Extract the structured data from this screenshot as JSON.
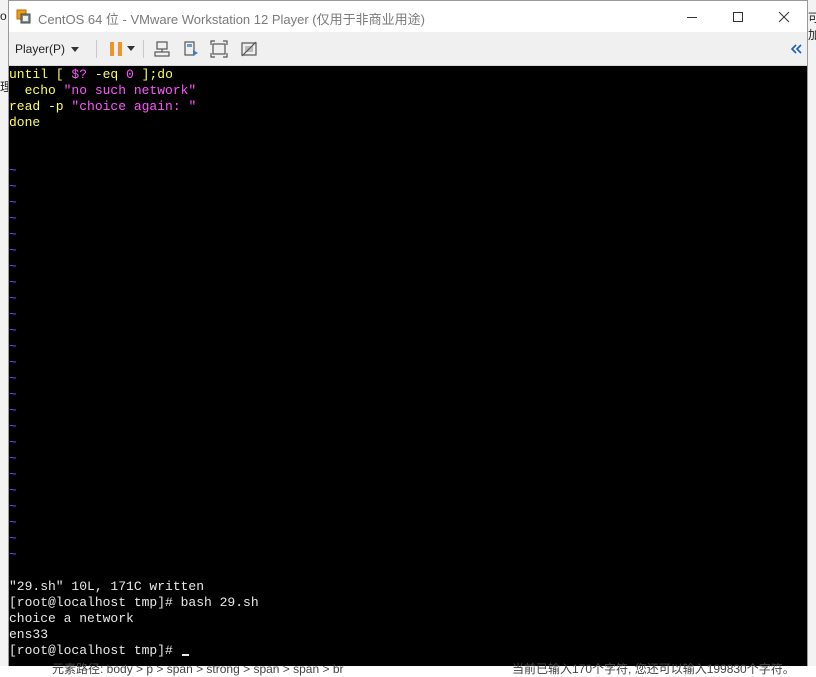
{
  "window": {
    "title": "CentOS 64 位 - VMware Workstation 12 Player (仅用于非商业用途)",
    "icon": "vmware-player-icon",
    "controls": [
      "minimize-icon",
      "maximize-icon",
      "close-icon"
    ]
  },
  "toolbar": {
    "player_menu_label": "Player(P)",
    "buttons": [
      "pause-icon",
      "send-ctrl-alt-del-icon",
      "removable-devices-icon",
      "full-screen-icon",
      "unity-icon",
      "collapse-icon"
    ]
  },
  "terminal": {
    "script_lines": [
      {
        "parts": [
          {
            "t": "until [ ",
            "c": "yellow"
          },
          {
            "t": "$?",
            "c": "magenta"
          },
          {
            "t": " -eq ",
            "c": "yellow"
          },
          {
            "t": "0",
            "c": "magenta"
          },
          {
            "t": " ];do",
            "c": "yellow"
          }
        ]
      },
      {
        "parts": [
          {
            "t": "  echo ",
            "c": "yellow"
          },
          {
            "t": "\"no such network\"",
            "c": "magenta"
          }
        ]
      },
      {
        "parts": [
          {
            "t": "read -p ",
            "c": "yellow"
          },
          {
            "t": "\"choice again: \"",
            "c": "magenta"
          }
        ]
      },
      {
        "parts": [
          {
            "t": "done",
            "c": "yellow"
          }
        ]
      }
    ],
    "tilde_char": "~",
    "tilde_count": 25,
    "output_lines": [
      "\"29.sh\" 10L, 171C written",
      "[root@localhost tmp]# bash 29.sh",
      "choice a network",
      "ens33",
      "[root@localhost tmp]# "
    ]
  },
  "background": {
    "right_edge_text": "可加",
    "left_edge_text": "o",
    "left_edge_text_2": "理",
    "breadcrumb": "元素路径: body > p > span > strong > span > span > br",
    "char_count": "当前已输入170个字符, 您还可以输入199830个字符。"
  }
}
